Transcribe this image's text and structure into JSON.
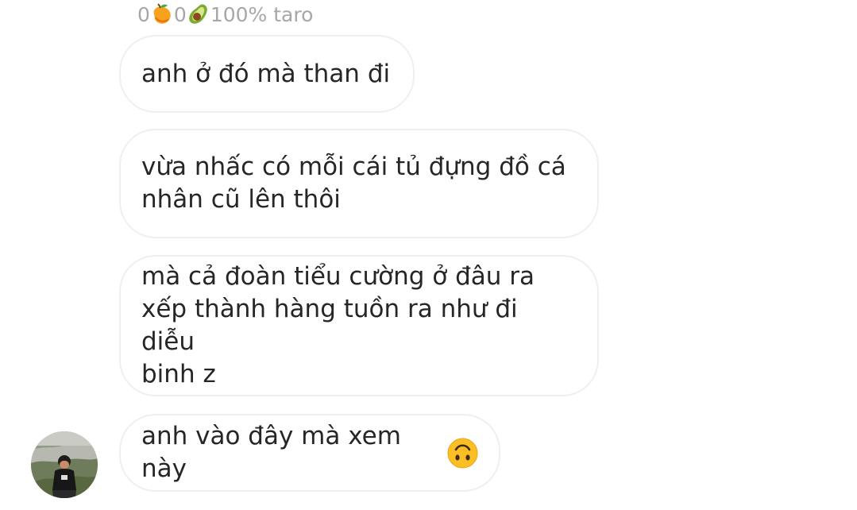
{
  "header": {
    "count_1": "0",
    "emoji_1": "mango-emoji",
    "count_2": "0",
    "emoji_2": "avocado-emoji",
    "status": "100% taro"
  },
  "messages": [
    {
      "text": "anh ở đó mà than đi"
    },
    {
      "text": "vừa nhấc có mỗi cái tủ đựng đồ cá\nnhân cũ lên thôi"
    },
    {
      "text": "mà cả đoàn tiểu cường ở đâu ra\nxếp thành hàng tuồn ra như đi diễu\nbinh z"
    },
    {
      "text": "anh vào đây mà xem này",
      "emoji": "upside-down-face-emoji"
    }
  ],
  "sender": {
    "avatar": "profile-photo"
  },
  "colors": {
    "bubble_border": "#efefef",
    "text": "#262626",
    "header_text": "#a7a7a7",
    "background": "#ffffff"
  }
}
